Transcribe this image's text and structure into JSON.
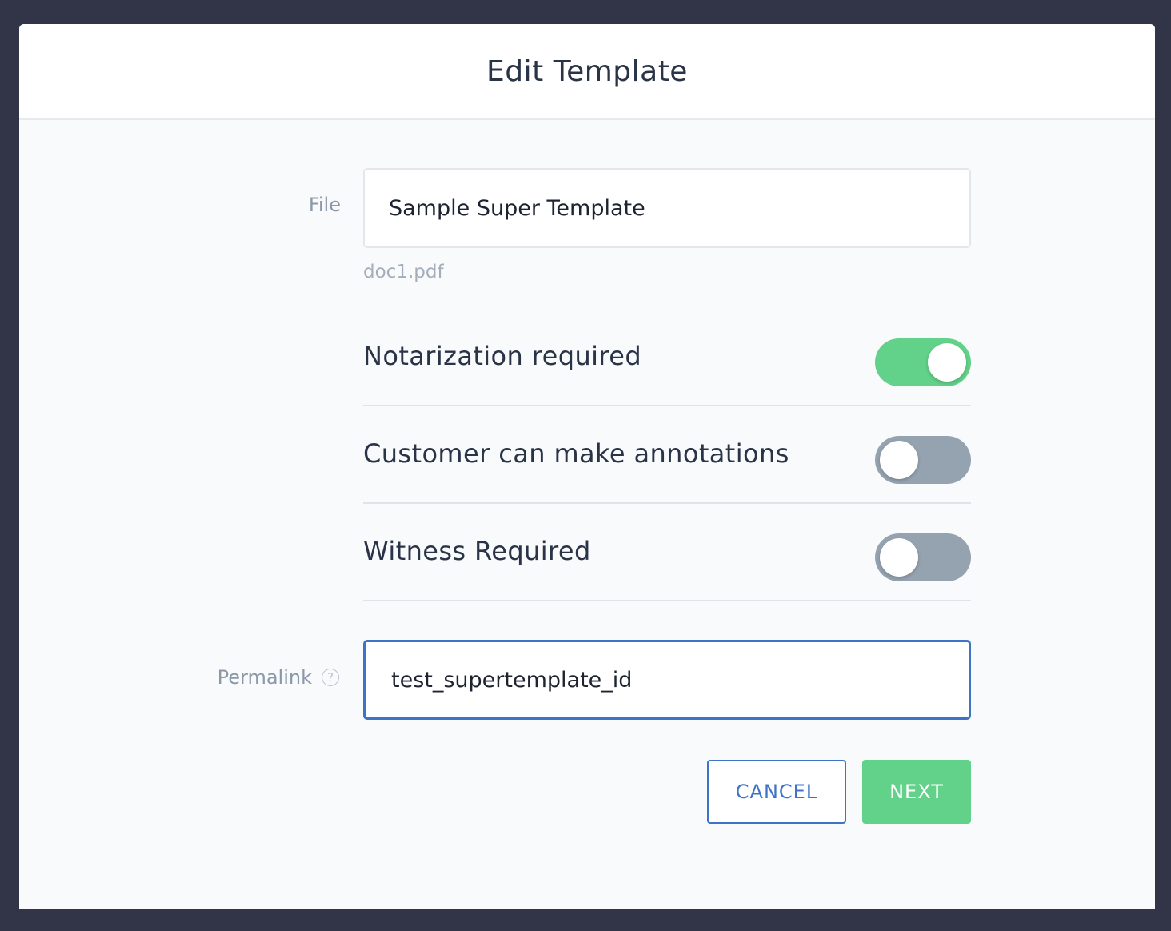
{
  "modal": {
    "title": "Edit Template"
  },
  "file": {
    "label": "File",
    "value": "Sample Super Template",
    "filename": "doc1.pdf"
  },
  "toggles": [
    {
      "label": "Notarization required",
      "on": true
    },
    {
      "label": "Customer can make annotations",
      "on": false
    },
    {
      "label": "Witness Required",
      "on": false
    }
  ],
  "permalink": {
    "label": "Permalink",
    "help_icon": "?",
    "value": "test_supertemplate_id"
  },
  "actions": {
    "cancel_label": "CANCEL",
    "next_label": "NEXT"
  },
  "colors": {
    "accent_blue": "#3d74c8",
    "toggle_on": "#62d189",
    "toggle_off": "#95a3b1",
    "backdrop": "#323548"
  }
}
